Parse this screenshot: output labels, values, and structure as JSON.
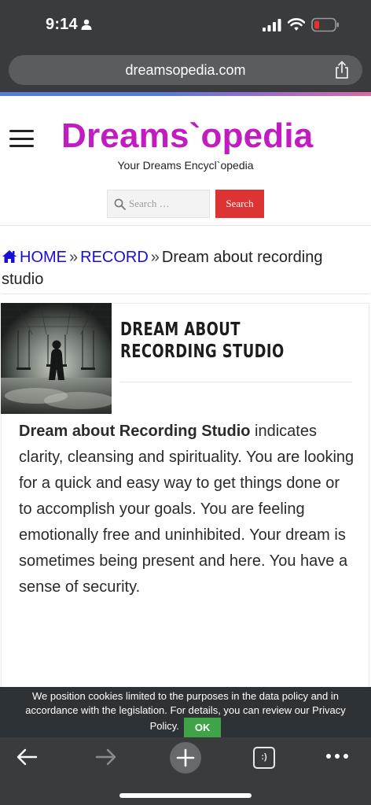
{
  "status_bar": {
    "time": "9:14"
  },
  "browser": {
    "url": "dreamsopedia.com"
  },
  "site": {
    "logo": "Dreams`opedia",
    "tagline": "Your Dreams Encycl`opedia",
    "search_placeholder": "Search …",
    "search_button": "Search"
  },
  "breadcrumb": {
    "home": "HOME",
    "separator": "»",
    "record": "RECORD",
    "current": "Dream about recording studio"
  },
  "article": {
    "title": "Dream about Recording Studio",
    "body_lead": "Dream about Recording Studio",
    "body_rest": " indicates clarity, cleansing and spirituality. You are looking for a quick and easy way to get things done or to accomplish your goals. You are feeling emotionally free and uninhibited. Your dream is sometimes being present and here. You have a sense of security."
  },
  "cookie_banner": {
    "text": "We position cookies limited to the purposes in the data policy and in accordance with the legislation. For details, you can review our Privacy Policy.",
    "ok_label": "OK"
  },
  "toolbar": {
    "tabs_label": ":)"
  },
  "colors": {
    "logo": "#c21bc2",
    "link": "#1a0fd6",
    "search_button": "#dd3333",
    "cookie_ok": "#3fa447",
    "chrome": "#3a3b3d"
  }
}
